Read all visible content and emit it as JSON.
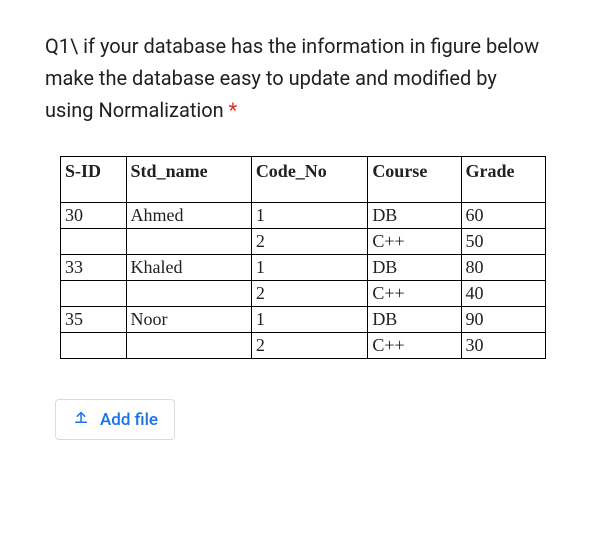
{
  "question": {
    "text": "Q1\\ if your database has the information in figure below make the database easy to update and modified by using Normalization",
    "required_marker": "*"
  },
  "table": {
    "headers": [
      "S-ID",
      "Std_name",
      "Code_No",
      "Course",
      "Grade"
    ],
    "rows": [
      {
        "sid": "30",
        "name": "Ahmed",
        "code": "1",
        "course": "DB",
        "grade": "60"
      },
      {
        "sid": "",
        "name": "",
        "code": "2",
        "course": "C++",
        "grade": "50"
      },
      {
        "sid": "33",
        "name": "Khaled",
        "code": "1",
        "course": "DB",
        "grade": "80"
      },
      {
        "sid": "",
        "name": "",
        "code": "2",
        "course": "C++",
        "grade": "40"
      },
      {
        "sid": "35",
        "name": "Noor",
        "code": "1",
        "course": "DB",
        "grade": "90"
      },
      {
        "sid": "",
        "name": "",
        "code": "2",
        "course": "C++",
        "grade": "30"
      }
    ]
  },
  "add_file": {
    "label": "Add file"
  }
}
